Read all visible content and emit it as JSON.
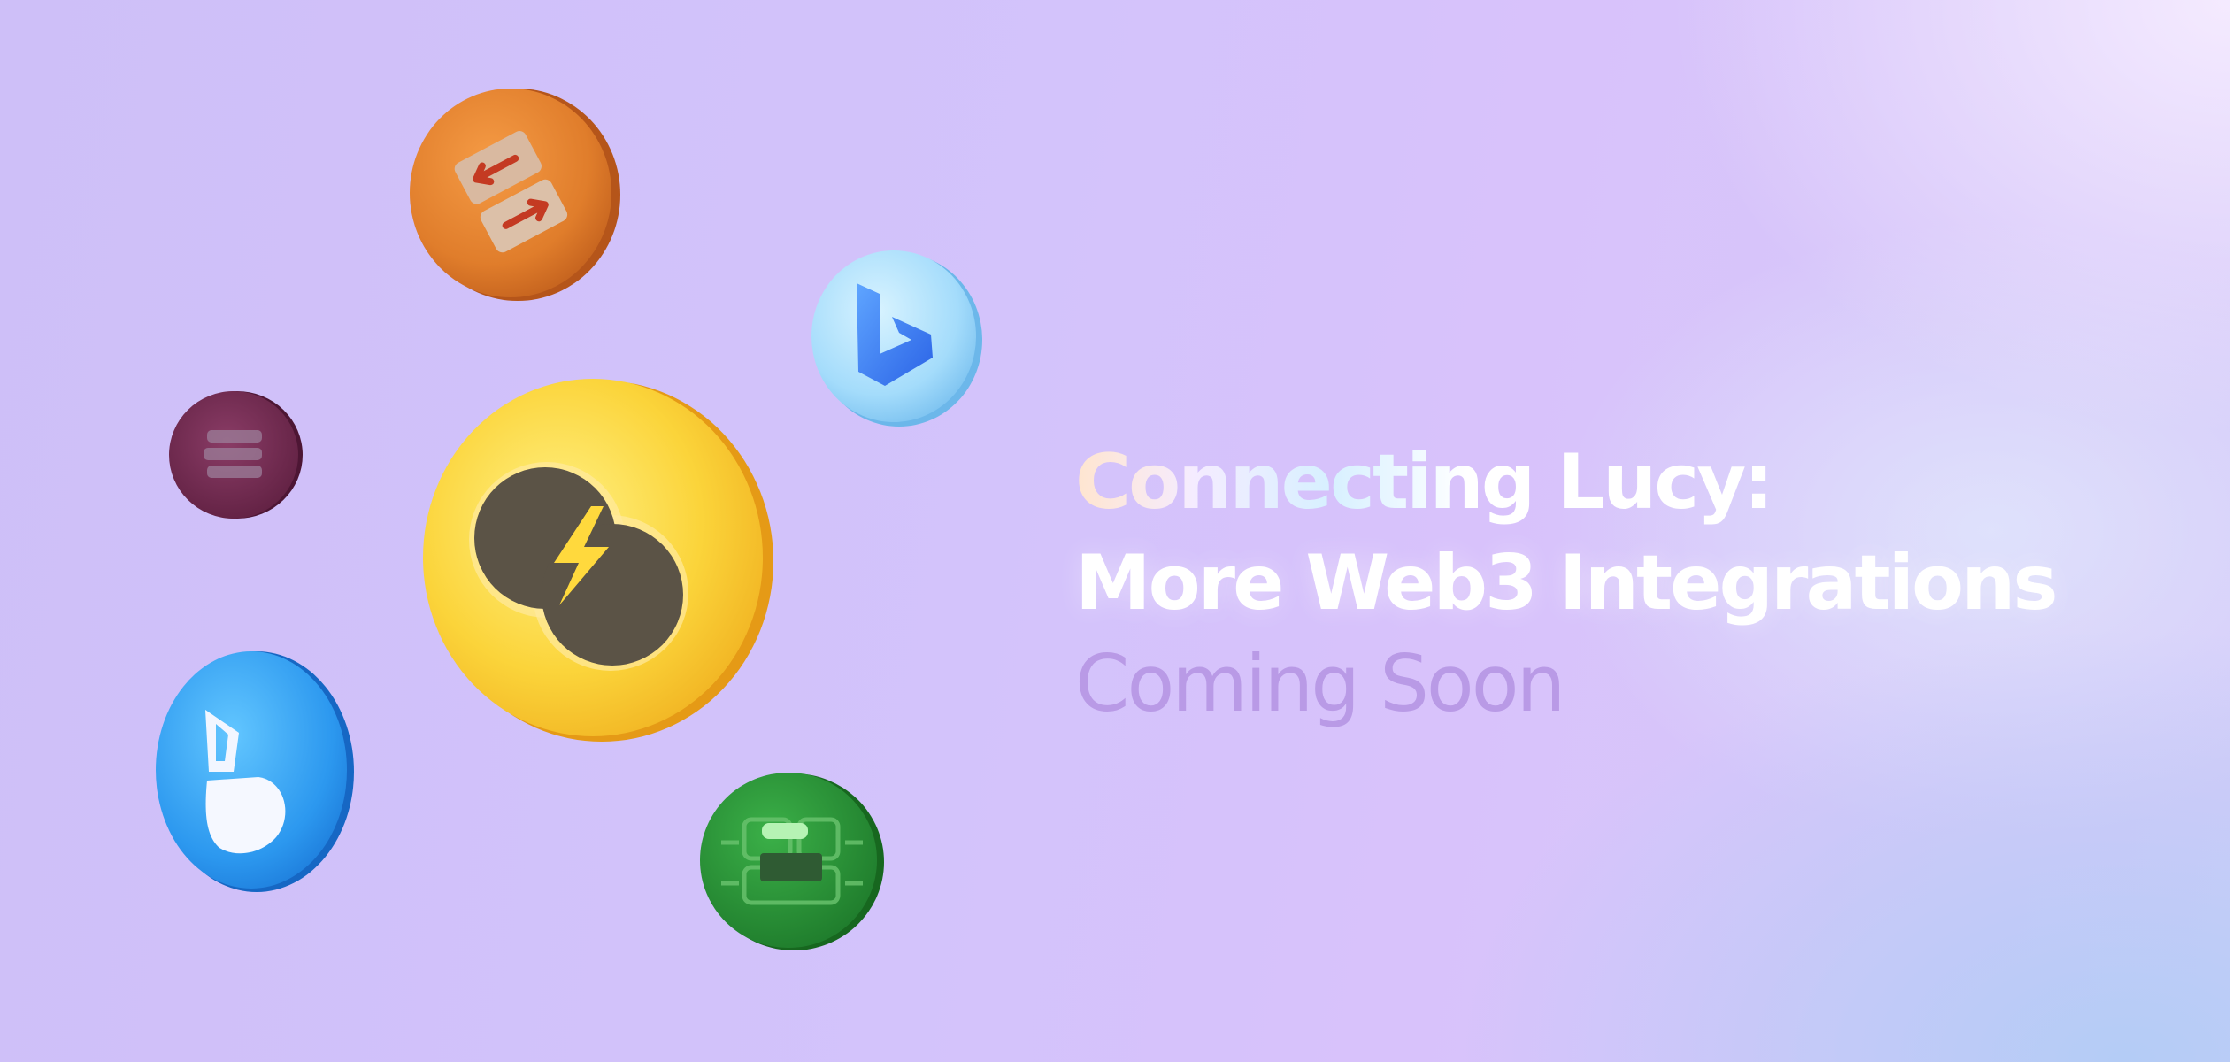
{
  "headline": {
    "line1": "Connecting Lucy:",
    "line2": "More Web3 Integrations",
    "line3": "Coming Soon"
  },
  "icons": [
    {
      "name": "swap-arrows-icon",
      "color": "#e88a33"
    },
    {
      "name": "bing-b-icon",
      "color": "#9fdcfb"
    },
    {
      "name": "stack-icon",
      "color": "#7a2f55"
    },
    {
      "name": "lightning-link-icon",
      "color": "#f9c82b"
    },
    {
      "name": "d-logo-icon",
      "color": "#35a6f4"
    },
    {
      "name": "circuit-icon",
      "color": "#2f9c3a"
    }
  ],
  "colors": {
    "background_left": "#cebff8",
    "background_right_bottom": "#b2ccf6",
    "headline_white": "#ffffff",
    "headline_muted": "#b99ae6"
  }
}
